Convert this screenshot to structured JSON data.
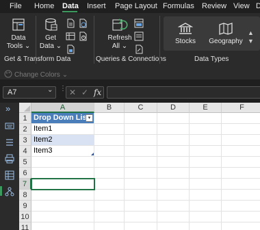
{
  "menu": {
    "items": [
      "File",
      "Home",
      "Data",
      "Insert",
      "Page Layout",
      "Formulas",
      "Review",
      "View",
      "D"
    ],
    "active": "Data"
  },
  "ribbon": {
    "data_tools": {
      "label_line1": "Data",
      "label_line2": "Tools",
      "chevron": "⌄"
    },
    "get_data": {
      "label_line1": "Get",
      "label_line2": "Data",
      "chevron": "⌄"
    },
    "refresh_all": {
      "label_line1": "Refresh",
      "label_line2": "All",
      "chevron": "⌄"
    },
    "stocks": {
      "label": "Stocks"
    },
    "geography": {
      "label": "Geography"
    },
    "groups": {
      "get_transform": "Get & Transform Data",
      "queries": "Queries & Connections",
      "data_types": "Data Types"
    },
    "change_colors": {
      "label": "Change Colors",
      "chevron": "⌄"
    }
  },
  "formula_bar": {
    "name_box": "A7",
    "name_box_chevron": "⌄",
    "cancel": "✕",
    "enter": "✓",
    "fx": "fx",
    "value": ""
  },
  "rail": {
    "expand": "»"
  },
  "grid": {
    "columns": [
      "A",
      "B",
      "C",
      "D",
      "E",
      "F"
    ],
    "selected_column": "A",
    "rows": [
      "1",
      "2",
      "3",
      "4",
      "5",
      "6",
      "7",
      "8",
      "9",
      "10",
      "11"
    ],
    "selected_row": "7",
    "table_header": "Drop Down List!",
    "filter_arrow": "▾",
    "cells": {
      "A2": "Item1",
      "A3": "Item2",
      "A4": "Item3"
    }
  },
  "colors": {
    "accent": "#217346",
    "table_header": "#4a7ebb",
    "table_band": "#d9e2f3"
  }
}
